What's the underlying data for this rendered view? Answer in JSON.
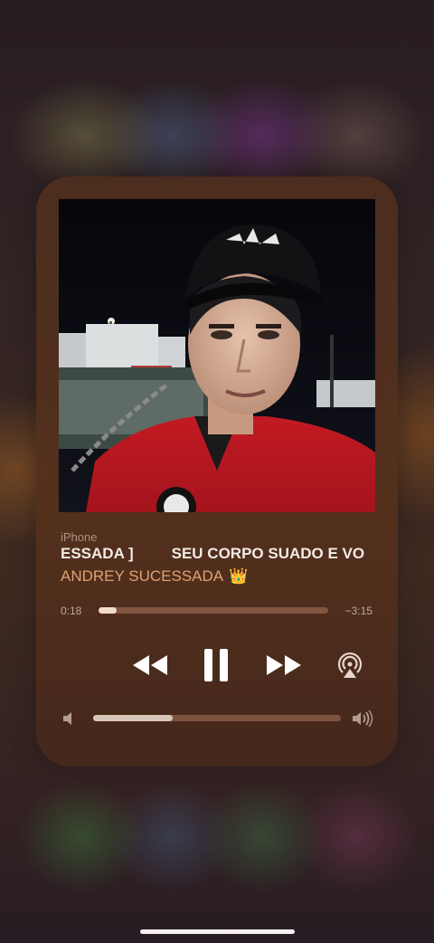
{
  "now_playing": {
    "source": "iPhone",
    "title_marquee": [
      "ESSADA ]",
      "SEU CORPO SUADO E VO"
    ],
    "artist": "ANDREY SUCESSADA",
    "artist_emoji": "👑",
    "elapsed": "0:18",
    "remaining": "−3:15",
    "progress_fraction": 0.08,
    "volume_fraction": 0.32
  },
  "icons": {
    "rewind": "rewind-icon",
    "pause": "pause-icon",
    "forward": "fast-forward-icon",
    "airplay": "airplay-icon",
    "volume_low": "speaker-low-icon",
    "volume_high": "speaker-high-icon"
  },
  "colors": {
    "accent": "#e0a171",
    "panel": "#4e2e1e",
    "title": "#f1ebe6"
  }
}
